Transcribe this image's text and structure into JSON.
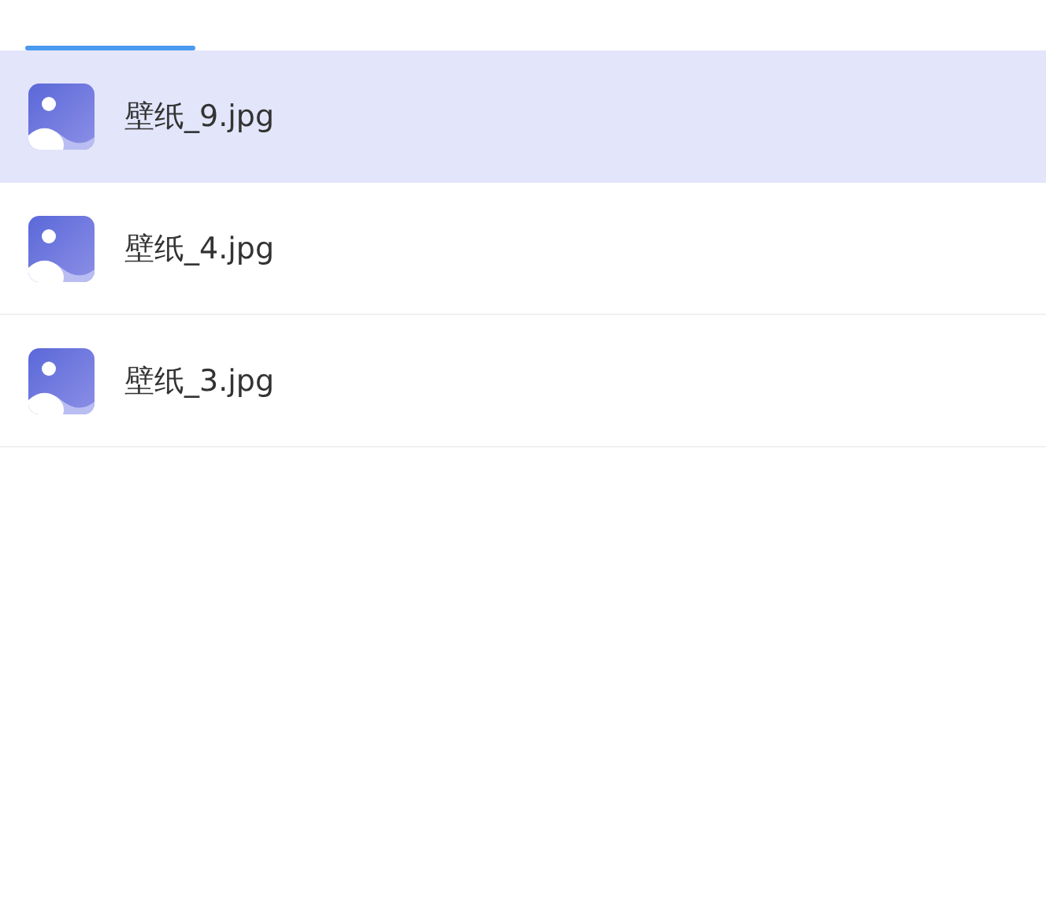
{
  "files": [
    {
      "name": "壁纸_9.jpg",
      "selected": true
    },
    {
      "name": "壁纸_4.jpg",
      "selected": false
    },
    {
      "name": "壁纸_3.jpg",
      "selected": false
    }
  ]
}
